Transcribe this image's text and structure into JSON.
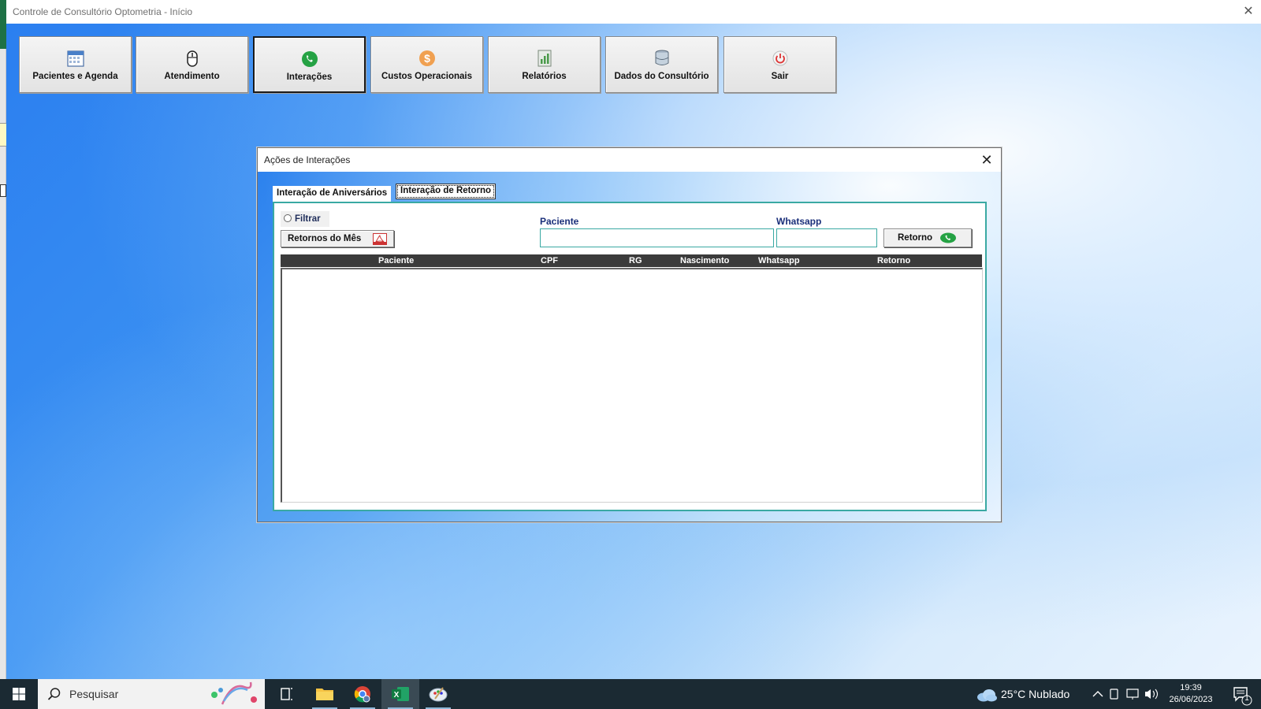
{
  "window": {
    "title": "Controle de Consultório Optometria - Início",
    "close_glyph": "✕"
  },
  "toolbar": {
    "buttons": [
      {
        "label": "Pacientes e Agenda",
        "icon": "calendar-icon"
      },
      {
        "label": "Atendimento",
        "icon": "mouse-icon"
      },
      {
        "label": "Interações",
        "icon": "whatsapp-icon"
      },
      {
        "label": "Custos Operacionais",
        "icon": "dollar-coin-icon"
      },
      {
        "label": "Relatórios",
        "icon": "report-chart-icon"
      },
      {
        "label": "Dados do Consultório",
        "icon": "database-icon"
      },
      {
        "label": "Sair",
        "icon": "power-icon"
      }
    ],
    "active_index": 2
  },
  "dialog": {
    "title": "Ações de Interações",
    "close_glyph": "✕",
    "tabs": [
      "Interação de Aniversários",
      "Interação de Retorno"
    ],
    "selected_tab": 1,
    "filter_label": "Filtrar",
    "retornos_button": "Retornos  do Mês",
    "paciente_label": "Paciente",
    "paciente_value": "",
    "whatsapp_label": "Whatsapp",
    "whatsapp_value": "",
    "retorno_button": "Retorno",
    "columns": [
      "Paciente",
      "CPF",
      "RG",
      "Nascimento",
      "Whatsapp",
      "Retorno"
    ],
    "rows": []
  },
  "taskbar": {
    "search_placeholder": "Pesquisar",
    "weather": "25°C  Nublado",
    "time": "19:39",
    "date": "26/06/2023",
    "notification_count": "1"
  },
  "colors": {
    "accent_teal": "#3aa9a3",
    "header_dark": "#3b3b3b",
    "whatsapp_green": "#25a244",
    "taskbar": "#1b2a33"
  }
}
